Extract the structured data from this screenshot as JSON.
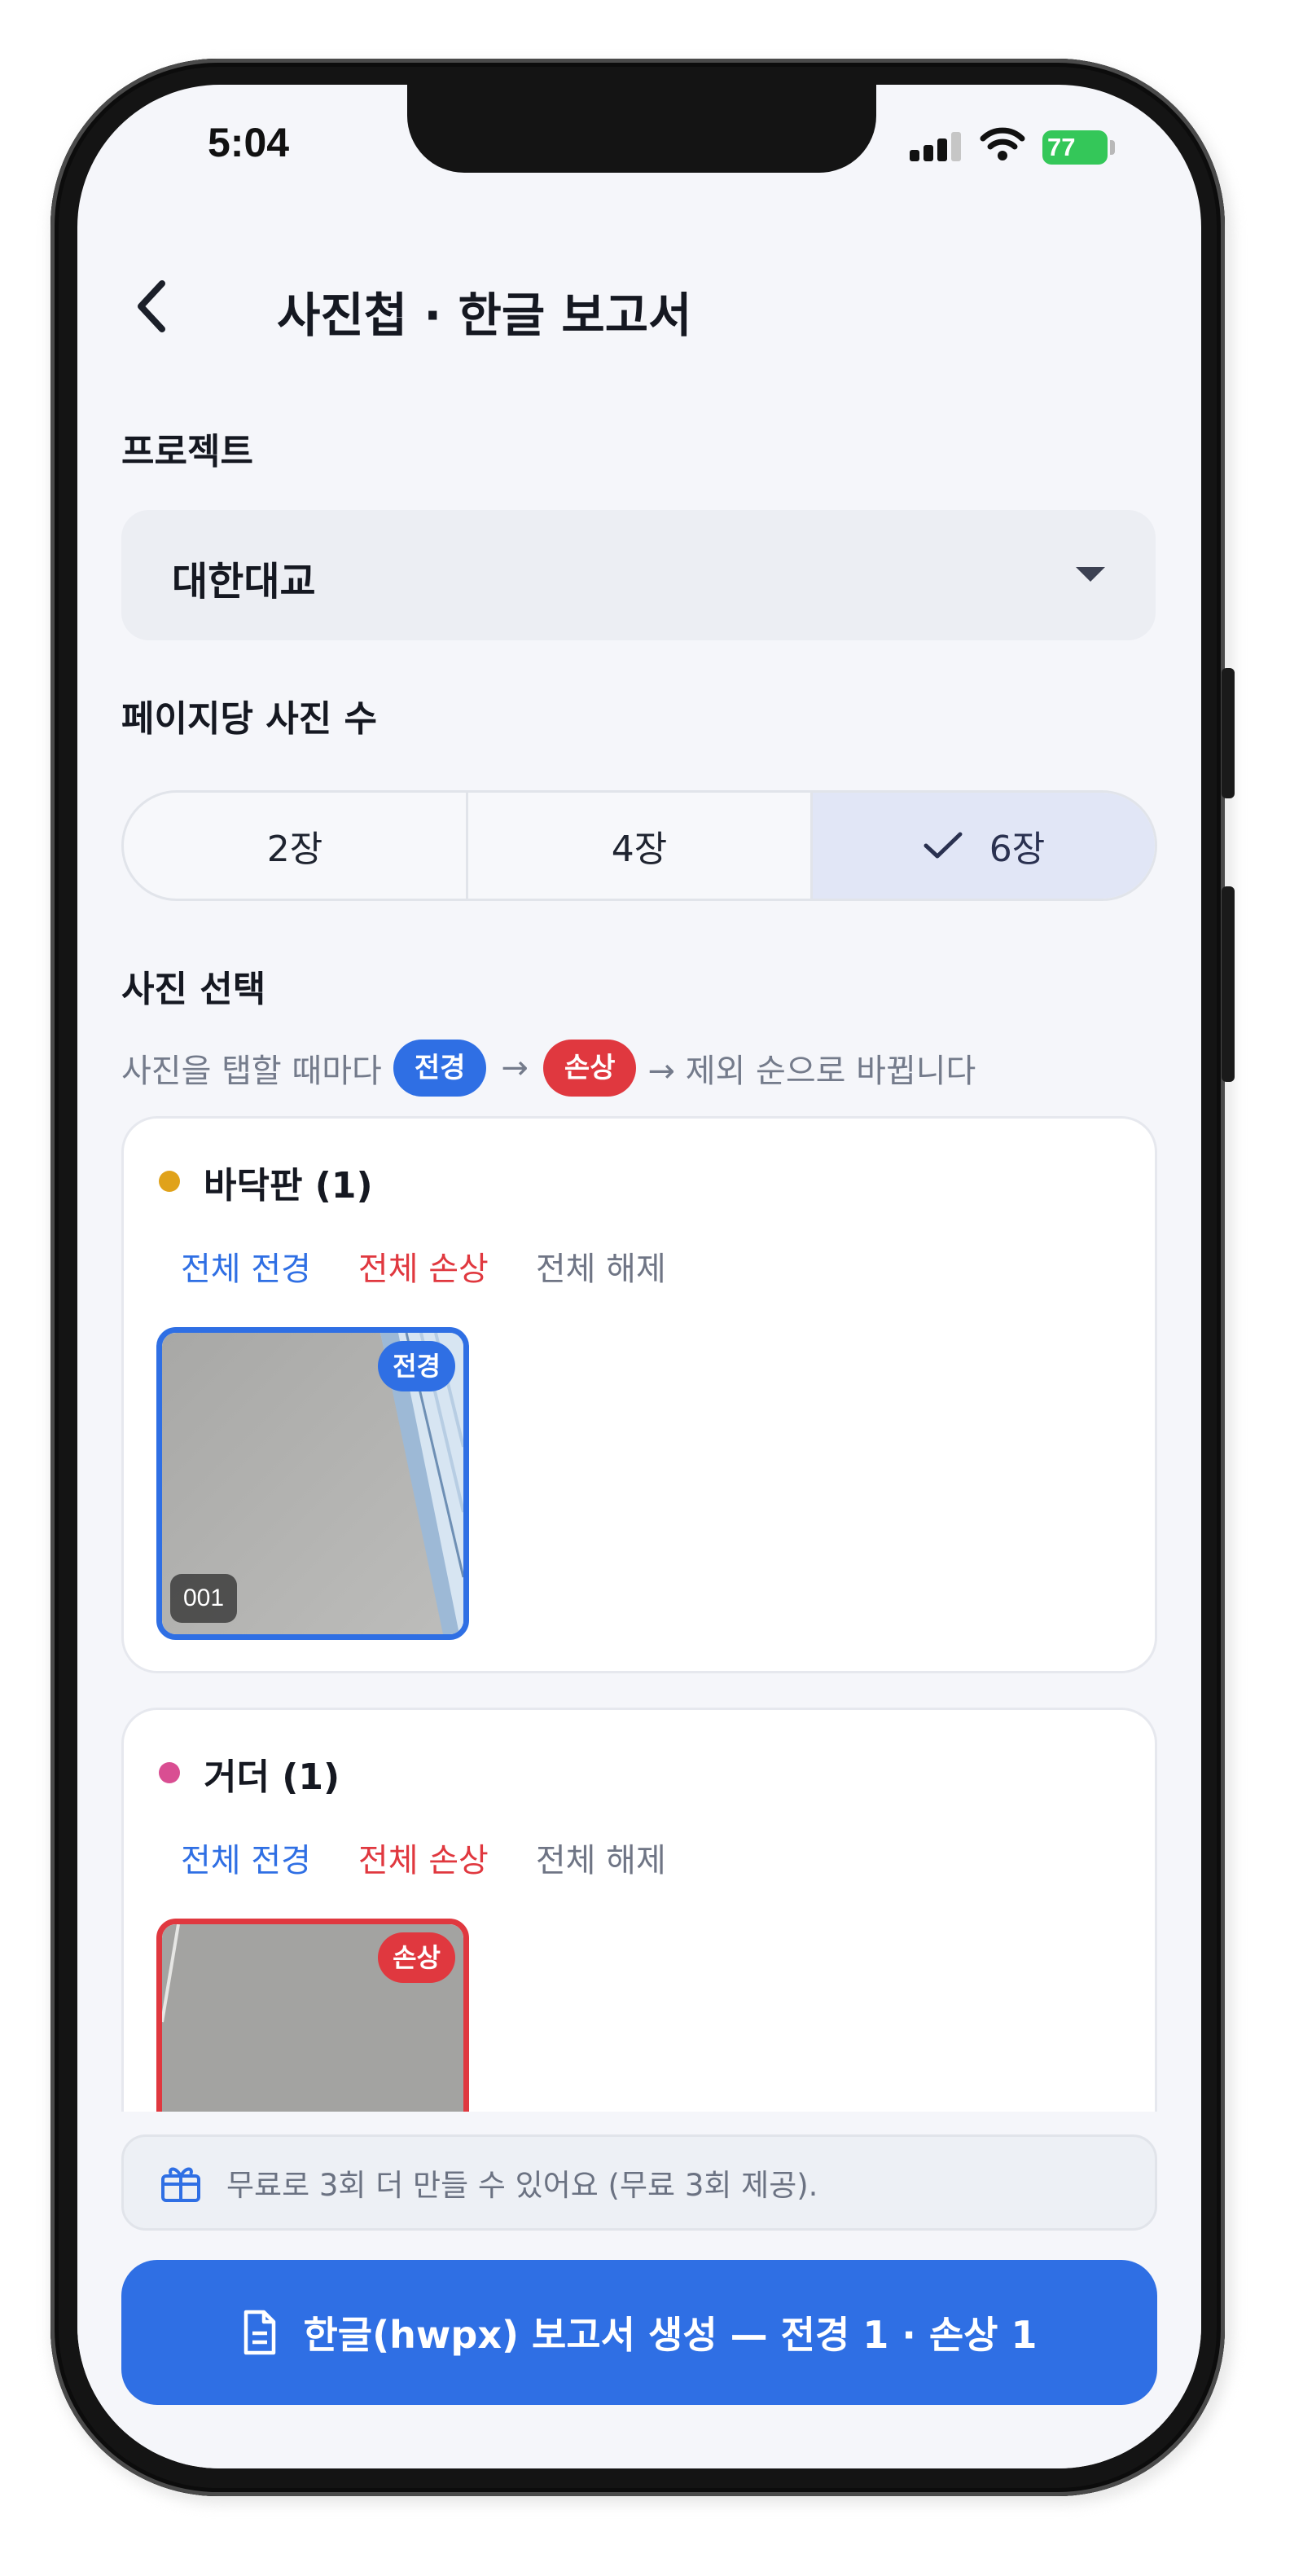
{
  "status_bar": {
    "time": "5:04",
    "battery": "77"
  },
  "header": {
    "title": "사진첩 · 한글 보고서"
  },
  "project": {
    "label": "프로젝트",
    "selected": "대한대교"
  },
  "per_page": {
    "label": "페이지당 사진 수",
    "options": [
      "2장",
      "4장",
      "6장"
    ],
    "selected_index": 2
  },
  "photo_select": {
    "label": "사진 선택",
    "hint_prefix": "사진을 탭할 때마다",
    "arrow": "→",
    "pill_overview": "전경",
    "pill_damage": "손상",
    "hint_suffix": "→ 제외 순으로 바뀝니다"
  },
  "groups": [
    {
      "name": "바닥판 (1)",
      "dot_color": "#e0a21a",
      "actions": {
        "all_overview": "전체 전경",
        "all_damage": "전체 손상",
        "clear_all": "전체 해제"
      },
      "photo": {
        "badge": "전경",
        "number": "001",
        "state": "overview"
      }
    },
    {
      "name": "거더 (1)",
      "dot_color": "#d94e92",
      "actions": {
        "all_overview": "전체 전경",
        "all_damage": "전체 손상",
        "clear_all": "전체 해제"
      },
      "photo": {
        "badge": "손상",
        "state": "damage"
      }
    }
  ],
  "footer": {
    "free_notice": "무료로 3회 더 만들 수 있어요 (무료 3회 제공).",
    "generate_label": "한글(hwpx) 보고서 생성 — 전경 1 · 손상 1"
  },
  "colors": {
    "accent": "#2f6fe4",
    "danger": "#e0383f",
    "battery": "#34c759"
  }
}
